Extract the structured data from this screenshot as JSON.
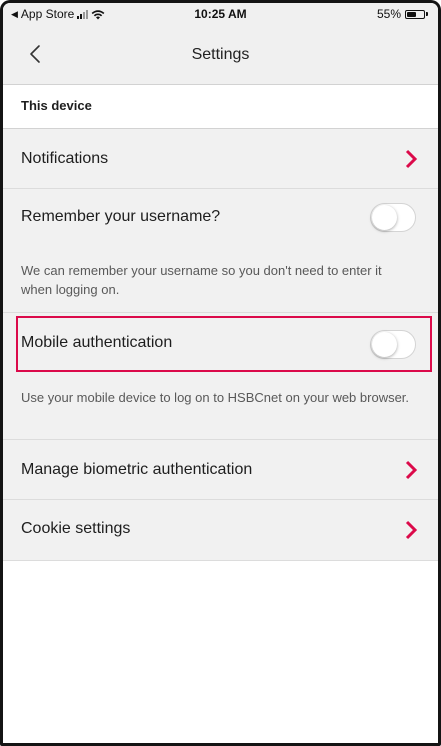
{
  "status_bar": {
    "back_app": "App Store",
    "time": "10:25 AM",
    "battery_percent": "55%",
    "battery_level": 0.55,
    "signal_icon": "signal-bars-icon",
    "wifi_icon": "wifi-icon"
  },
  "nav": {
    "title": "Settings",
    "back_icon": "chevron-left-icon"
  },
  "section": {
    "title": "This device"
  },
  "rows": {
    "notifications": {
      "label": "Notifications",
      "icon": "chevron-right-icon"
    },
    "remember_username": {
      "label": "Remember your username?",
      "toggle_on": false,
      "description": "We can remember your username so you don't need to enter it when logging on."
    },
    "mobile_auth": {
      "label": "Mobile authentication",
      "toggle_on": false,
      "description": "Use your mobile device to log on to HSBCnet on your web browser."
    },
    "biometric": {
      "label": "Manage biometric authentication",
      "icon": "chevron-right-icon"
    },
    "cookies": {
      "label": "Cookie settings",
      "icon": "chevron-right-icon"
    }
  },
  "colors": {
    "accent_red": "#db0a4a",
    "highlight_border": "#db0a4a",
    "background_grey": "#f1f1f1"
  }
}
